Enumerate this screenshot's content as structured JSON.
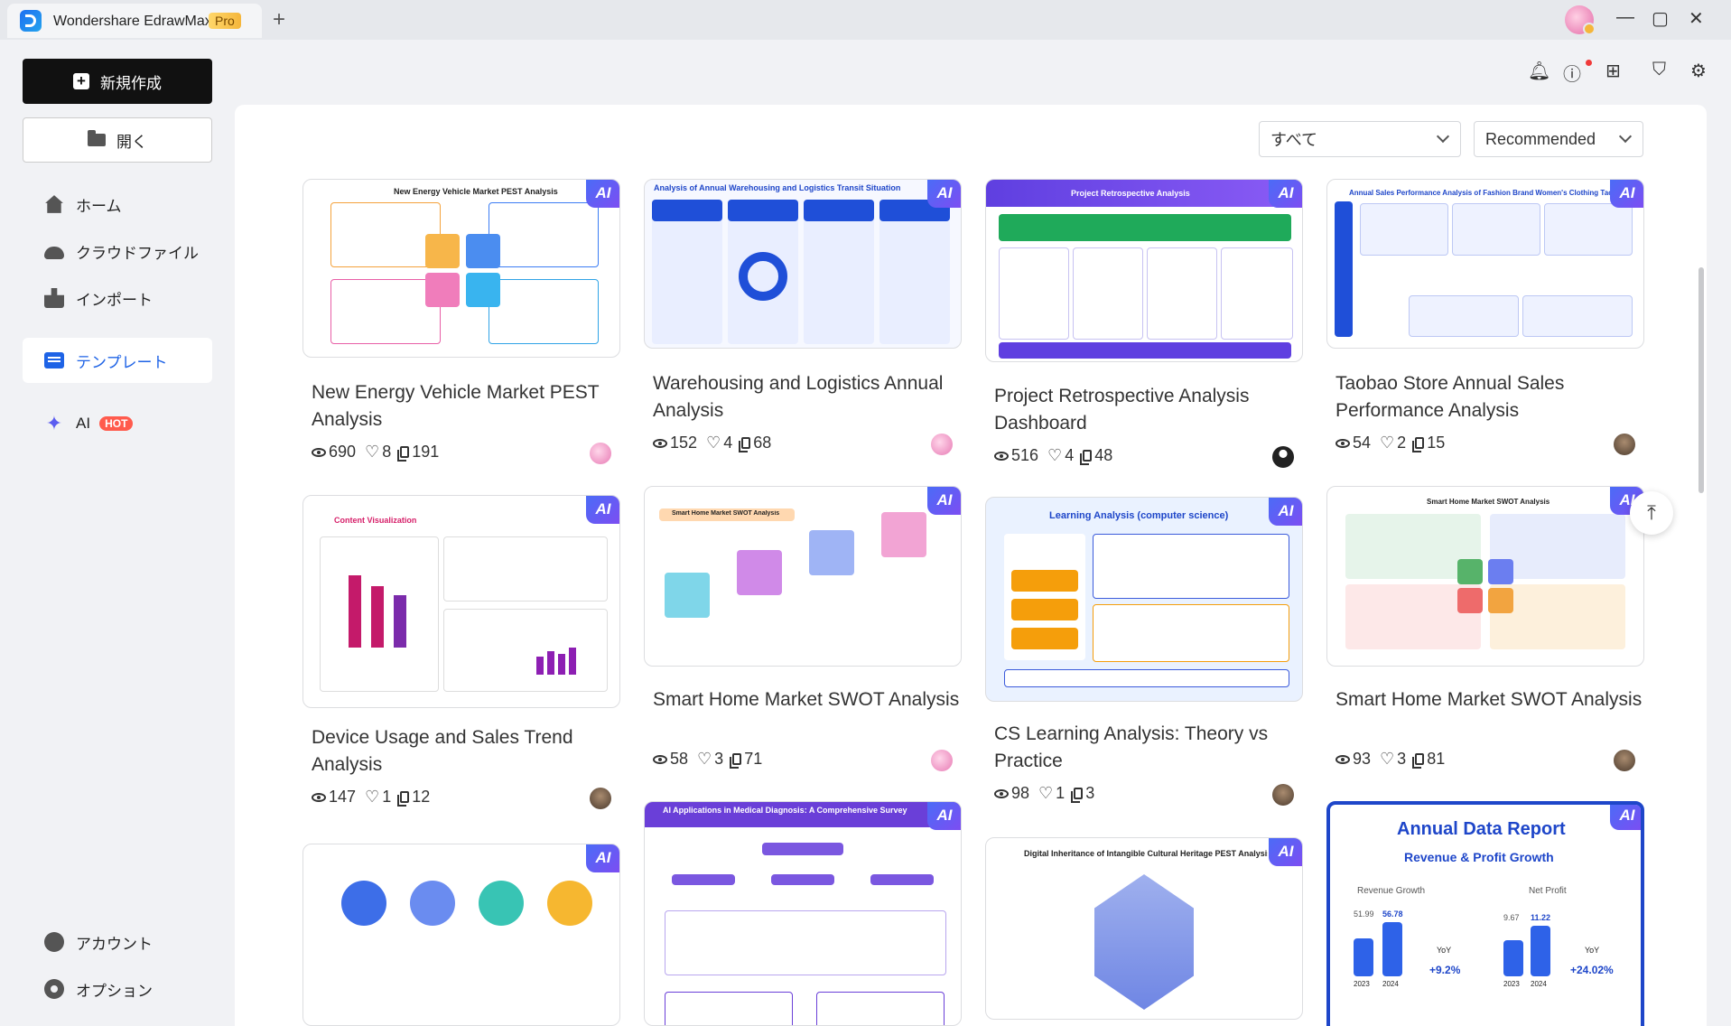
{
  "app": {
    "name": "Wondershare EdrawMax",
    "badge": "Pro",
    "new_tab": "+"
  },
  "window": {
    "minimize": "—",
    "maximize": "▢",
    "close": "✕"
  },
  "sidebar": {
    "new_label": "新規作成",
    "open_label": "開く",
    "items": [
      {
        "label": "ホーム"
      },
      {
        "label": "クラウドファイル"
      },
      {
        "label": "インポート"
      },
      {
        "label": "テンプレート"
      },
      {
        "label": "AI",
        "badge": "HOT"
      }
    ],
    "bottom": [
      {
        "label": "アカウント"
      },
      {
        "label": "オプション"
      }
    ]
  },
  "filters": {
    "category": "すべて",
    "sort": "Recommended"
  },
  "ai_badge": "AI",
  "cards": [
    {
      "title": "New Energy Vehicle Market PEST Analysis",
      "views": "690",
      "likes": "8",
      "copies": "191",
      "thumb_title": "New Energy Vehicle Market PEST Analysis"
    },
    {
      "title": "Warehousing and Logistics Annual Analysis",
      "views": "152",
      "likes": "4",
      "copies": "68",
      "thumb_title": "Analysis of Annual Warehousing and Logistics Transit Situation"
    },
    {
      "title": "Project Retrospective Analysis Dashboard",
      "views": "516",
      "likes": "4",
      "copies": "48",
      "thumb_title": "Project Retrospective Analysis"
    },
    {
      "title": "Taobao Store Annual Sales Performance Analysis",
      "views": "54",
      "likes": "2",
      "copies": "15",
      "thumb_title": "Annual Sales Performance Analysis of Fashion Brand Women's Clothing Taobao Store"
    },
    {
      "title": "Device Usage and Sales Trend Analysis",
      "views": "147",
      "likes": "1",
      "copies": "12",
      "thumb_title": "Content Visualization"
    },
    {
      "title": "Smart Home Market SWOT Analysis",
      "views": "58",
      "likes": "3",
      "copies": "71",
      "thumb_title": "Smart Home Market SWOT Analysis"
    },
    {
      "title": "CS Learning Analysis: Theory vs Practice",
      "views": "98",
      "likes": "1",
      "copies": "3",
      "thumb_title": "Learning Analysis (computer science)"
    },
    {
      "title": "Smart Home Market SWOT Analysis",
      "views": "93",
      "likes": "3",
      "copies": "81",
      "thumb_title": "Smart Home Market SWOT Analysis"
    },
    {
      "thumb_title": ""
    },
    {
      "thumb_title": "AI Applications in Medical Diagnosis: A Comprehensive Survey"
    },
    {
      "thumb_title": "Digital Inheritance of Intangible Cultural Heritage PEST Analysis"
    },
    {
      "thumb_title": "Annual Data Report",
      "thumb_sub": "Revenue & Profit Growth",
      "kpis": [
        {
          "label": "Revenue Growth",
          "v1": "51.99",
          "v2": "56.78",
          "yoy": "+9.2%"
        },
        {
          "label": "Net Profit",
          "v1": "9.67",
          "v2": "11.22",
          "yoy": "+24.02%"
        }
      ],
      "years": [
        "2023",
        "2024"
      ],
      "yoy_label": "YoY"
    }
  ]
}
